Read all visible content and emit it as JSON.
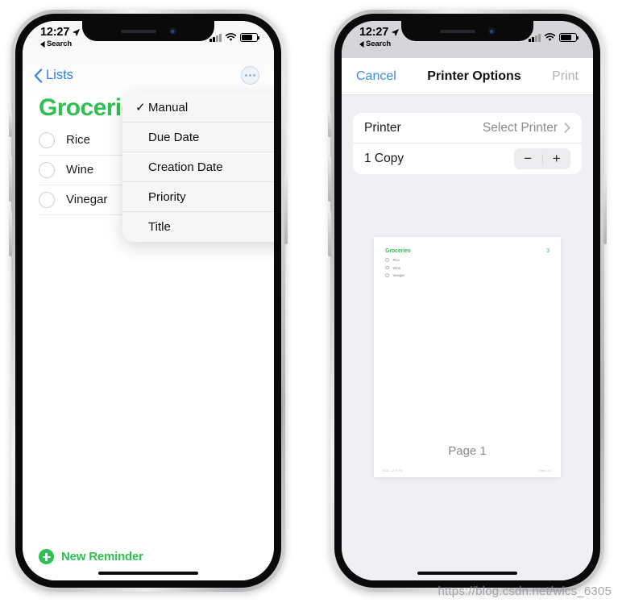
{
  "status_bar": {
    "time": "12:27",
    "back_label": "Search",
    "location_icon": "location-arrow-icon",
    "signal_icon": "cellular-signal-icon",
    "wifi_icon": "wifi-icon",
    "battery_icon": "battery-icon"
  },
  "colors": {
    "ios_green": "#2fbf53",
    "ios_blue": "#2f7fe8",
    "link_blue": "#3b8bee",
    "disabled_gray": "#b3b3b8",
    "panel_gray": "#efeff4"
  },
  "left_phone": {
    "app": "Reminders",
    "nav": {
      "back_label": "Lists",
      "back_icon": "chevron-left-icon",
      "more_icon": "ellipsis-circle-icon"
    },
    "list_title": "Groceries",
    "reminders": [
      {
        "label": "Rice"
      },
      {
        "label": "Wine"
      },
      {
        "label": "Vinegar"
      }
    ],
    "new_reminder": {
      "label": "New Reminder",
      "icon": "plus-circle-icon"
    },
    "sort_menu": {
      "checkmark": "✓",
      "items": [
        {
          "label": "Manual",
          "selected": true
        },
        {
          "label": "Due Date",
          "selected": false
        },
        {
          "label": "Creation Date",
          "selected": false
        },
        {
          "label": "Priority",
          "selected": false
        },
        {
          "label": "Title",
          "selected": false
        }
      ]
    }
  },
  "right_phone": {
    "app": "Printer Options",
    "nav": {
      "cancel_label": "Cancel",
      "title": "Printer Options",
      "print_label": "Print"
    },
    "options": {
      "printer_label": "Printer",
      "printer_value": "Select Printer",
      "printer_chevron_icon": "chevron-right-icon",
      "copies_label": "1 Copy",
      "stepper_minus": "−",
      "stepper_plus": "+"
    },
    "preview": {
      "page_label": "Page 1",
      "doc_title": "Groceries",
      "doc_count": "3",
      "doc_items": [
        "Rice",
        "Wine",
        "Vinegar"
      ],
      "footer_left": "2/1/21, 12:27 PM",
      "footer_right": "Page 1 of 1"
    }
  },
  "watermark": "https://blog.csdn.net/wlcs_6305"
}
